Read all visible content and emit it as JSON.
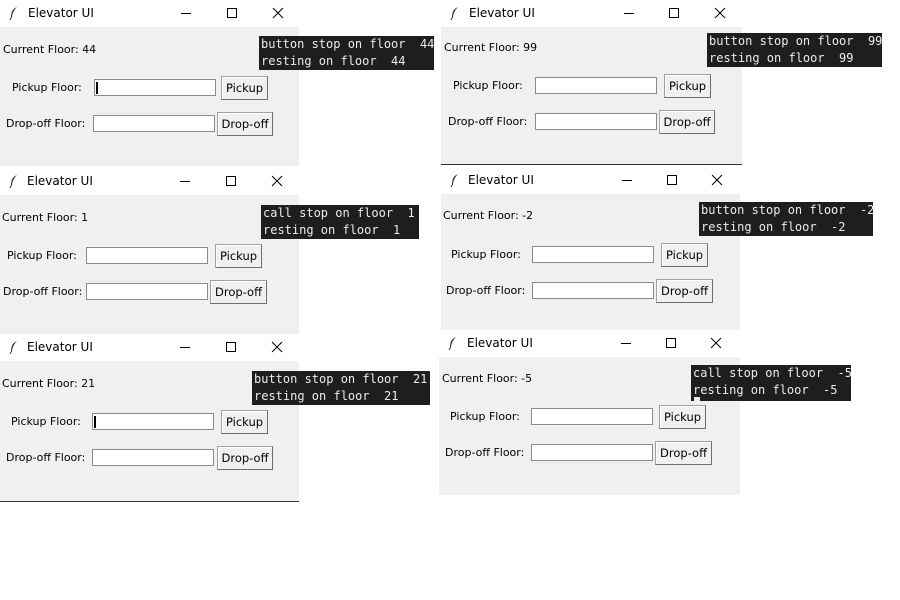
{
  "windows": [
    {
      "title": "Elevator UI",
      "current_floor": "Current Floor: 44",
      "pickup_label": "Pickup Floor:",
      "dropoff_label": "Drop-off Floor:",
      "pickup_button": "Pickup",
      "dropoff_button": "Drop-off",
      "pickup_value": "",
      "dropoff_value": "",
      "log": [
        "button stop on floor  44",
        "resting on floor  44"
      ]
    },
    {
      "title": "Elevator UI",
      "current_floor": "Current Floor: 99",
      "pickup_label": "Pickup Floor:",
      "dropoff_label": "Drop-off Floor:",
      "pickup_button": "Pickup",
      "dropoff_button": "Drop-off",
      "pickup_value": "",
      "dropoff_value": "",
      "log": [
        "button stop on floor  99",
        "resting on floor  99"
      ]
    },
    {
      "title": "Elevator UI",
      "current_floor": "Current Floor: 1",
      "pickup_label": "Pickup Floor:",
      "dropoff_label": "Drop-off Floor:",
      "pickup_button": "Pickup",
      "dropoff_button": "Drop-off",
      "pickup_value": "",
      "dropoff_value": "",
      "log": [
        "call stop on floor  1",
        "resting on floor  1"
      ]
    },
    {
      "title": "Elevator UI",
      "current_floor": "Current Floor: -2",
      "pickup_label": "Pickup Floor:",
      "dropoff_label": "Drop-off Floor:",
      "pickup_button": "Pickup",
      "dropoff_button": "Drop-off",
      "pickup_value": "",
      "dropoff_value": "",
      "log": [
        "button stop on floor  -2",
        "resting on floor  -2"
      ]
    },
    {
      "title": "Elevator UI",
      "current_floor": "Current Floor: 21",
      "pickup_label": "Pickup Floor:",
      "dropoff_label": "Drop-off Floor:",
      "pickup_button": "Pickup",
      "dropoff_button": "Drop-off",
      "pickup_value": "",
      "dropoff_value": "",
      "log": [
        "button stop on floor  21",
        "resting on floor  21"
      ]
    },
    {
      "title": "Elevator UI",
      "current_floor": "Current Floor: -5",
      "pickup_label": "Pickup Floor:",
      "dropoff_label": "Drop-off Floor:",
      "pickup_button": "Pickup",
      "dropoff_button": "Drop-off",
      "pickup_value": "",
      "dropoff_value": "",
      "log": [
        "call stop on floor  -5",
        "resting on floor  -5"
      ]
    }
  ],
  "icons": {
    "app": "feather-icon",
    "minimize": "minimize-icon",
    "maximize": "maximize-icon",
    "close": "close-icon"
  }
}
